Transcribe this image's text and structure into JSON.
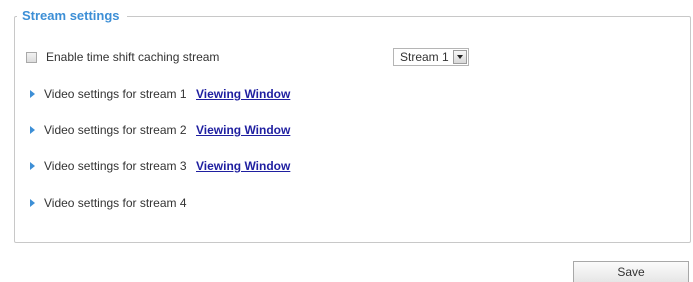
{
  "stream_settings": {
    "legend": "Stream settings",
    "enable_time_shift_label": "Enable time shift caching stream",
    "stream_select_value": "Stream 1",
    "items": [
      {
        "label": "Video settings for stream 1",
        "link": "Viewing Window"
      },
      {
        "label": "Video settings for stream 2",
        "link": "Viewing Window"
      },
      {
        "label": "Video settings for stream 3",
        "link": "Viewing Window"
      },
      {
        "label": "Video settings for stream 4",
        "link": ""
      }
    ]
  },
  "actions": {
    "save_label": "Save"
  },
  "colors": {
    "accent": "#3d8fd6",
    "link": "#1f1fa0",
    "border": "#c8c8c8"
  },
  "icons": {
    "expand": "triangle-right-icon",
    "dropdown": "chevron-down-icon"
  }
}
